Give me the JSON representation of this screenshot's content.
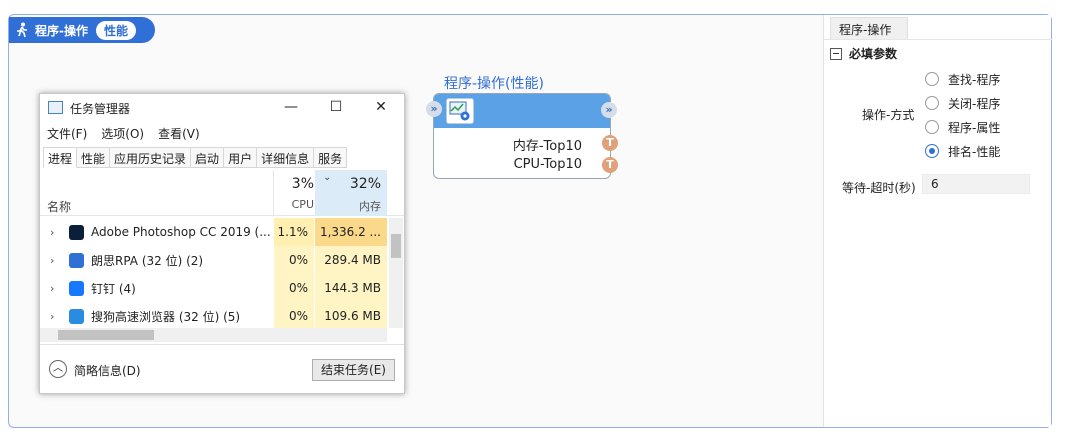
{
  "header": {
    "title": "程序-操作",
    "badge": "性能"
  },
  "node": {
    "title": "程序-操作(性能)",
    "in_port": "»",
    "out_port": "»",
    "outputs": [
      {
        "label": "内存-Top10",
        "port": "T"
      },
      {
        "label": "CPU-Top10",
        "port": "T"
      }
    ]
  },
  "task_manager": {
    "title": "任务管理器",
    "window_buttons": {
      "minimize": "—",
      "maximize": "☐",
      "close": "✕"
    },
    "menu": [
      "文件(F)",
      "选项(O)",
      "查看(V)"
    ],
    "tabs": [
      "进程",
      "性能",
      "应用历史记录",
      "启动",
      "用户",
      "详细信息",
      "服务"
    ],
    "columns": {
      "name": "名称",
      "cpu_pct": "3%",
      "cpu": "CPU",
      "mem_pct": "32%",
      "mem": "内存"
    },
    "rows": [
      {
        "name": "Adobe Photoshop CC 2019 (...",
        "cpu": "1.1%",
        "mem": "1,336.2 ...",
        "icon": "photoshop-icon",
        "icon_color": "#0b1f3b"
      },
      {
        "name": "朗思RPA (32 位) (2)",
        "cpu": "0%",
        "mem": "289.4 MB",
        "icon": "rpa-icon",
        "icon_color": "#2f6fd6"
      },
      {
        "name": "钉钉 (4)",
        "cpu": "0%",
        "mem": "144.3 MB",
        "icon": "dingtalk-icon",
        "icon_color": "#1677ff"
      },
      {
        "name": "搜狗高速浏览器 (32 位) (5)",
        "cpu": "0%",
        "mem": "109.6 MB",
        "icon": "sogou-browser-icon",
        "icon_color": "#2a8ce0"
      }
    ],
    "footer": {
      "brief": "简略信息(D)",
      "end_task": "结束任务(E)"
    }
  },
  "panel": {
    "tab": "程序-操作",
    "section": "必填参数",
    "radio_label": "操作-方式",
    "options": [
      {
        "label": "查找-程序",
        "checked": false
      },
      {
        "label": "关闭-程序",
        "checked": false
      },
      {
        "label": "程序-属性",
        "checked": false
      },
      {
        "label": "排名-性能",
        "checked": true
      }
    ],
    "timeout_label": "等待-超时(秒)",
    "timeout_value": "6"
  },
  "colors": {
    "accent": "#2f6fd6",
    "node_header": "#5aa1e6",
    "port_t": "#e0a07a"
  }
}
